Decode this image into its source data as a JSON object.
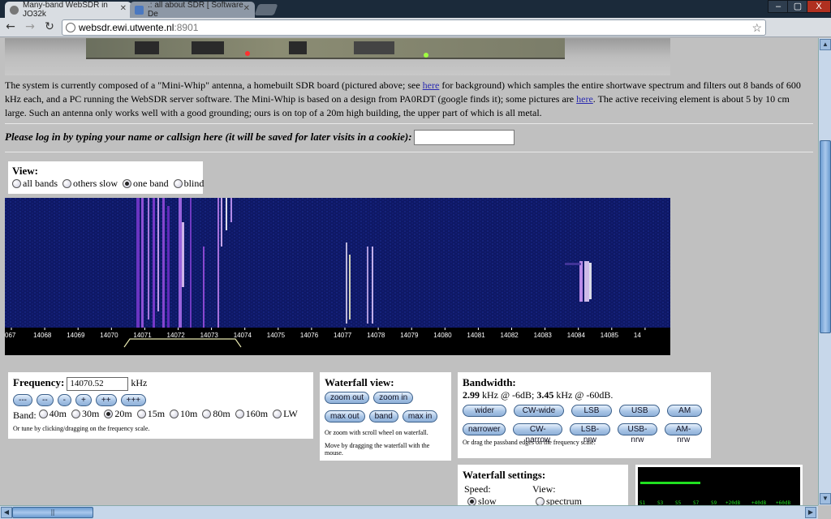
{
  "browser": {
    "tabs": [
      {
        "title": "Many-band WebSDR in JO32k",
        "active": true
      },
      {
        "title": ".: all about SDR [ Software De",
        "active": false
      }
    ],
    "window_controls": [
      "–",
      "▢",
      "X"
    ],
    "url_host": "websdr.ewi.utwente.nl",
    "url_port": ":8901"
  },
  "intro": {
    "p1": "The system is currently composed of a \"Mini-Whip\" antenna, a homebuilt SDR board (pictured above; see ",
    "link1": "here",
    "p2": " for background) which samples the entire shortwave spectrum and filters out 8 bands of 600 kHz each, and a PC running the WebSDR server software. The Mini-Whip is based on a design from PA0RDT (google finds it); some pictures are ",
    "link2": "here",
    "p3": ". The active receiving element is about 5 by 10 cm large. Such an antenna only works well with a good grounding; ours is on top of a 20m high building, the upper part of which is all metal."
  },
  "login": {
    "prompt": "Please log in by typing your name or callsign here (it will be saved for later visits in a cookie):",
    "value": ""
  },
  "view": {
    "title": "View:",
    "options": [
      "all bands",
      "others slow",
      "one band",
      "blind"
    ],
    "selected": "one band"
  },
  "waterfall": {
    "scale_labels": [
      "067",
      "14068",
      "14069",
      "14070",
      "14071",
      "14072",
      "14073",
      "14074",
      "14075",
      "14076",
      "14077",
      "14078",
      "14079",
      "14080",
      "14081",
      "14082",
      "14083",
      "14084",
      "14085",
      "14"
    ]
  },
  "frequency": {
    "label": "Frequency:",
    "value": "14070.52",
    "unit": "kHz",
    "step_buttons": [
      "---",
      "--",
      "-",
      "+",
      "++",
      "+++"
    ],
    "band_label": "Band:",
    "bands": [
      "40m",
      "30m",
      "20m",
      "15m",
      "10m",
      "80m",
      "160m",
      "LW"
    ],
    "selected_band": "20m",
    "note": "Or tune by clicking/dragging on the frequency scale."
  },
  "waterfall_view": {
    "title": "Waterfall view:",
    "buttons": [
      "zoom out",
      "zoom in",
      "max out",
      "band",
      "max in"
    ],
    "note1": "Or zoom with scroll wheel on waterfall.",
    "note2": "Move by dragging the waterfall with the mouse."
  },
  "bandwidth": {
    "title": "Bandwidth:",
    "v1": "2.99",
    "t1": " kHz @ -6dB; ",
    "v2": "3.45",
    "t2": " kHz @ -60dB.",
    "row1": [
      "wider",
      "CW-wide",
      "LSB",
      "USB",
      "AM"
    ],
    "row2": [
      "narrower",
      "CW-narrow",
      "LSB-nrw",
      "USB-nrw",
      "AM-nrw"
    ],
    "note": "Or drag the passband edges on the frequency scale."
  },
  "waterfall_settings": {
    "title": "Waterfall settings:",
    "speed_label": "Speed:",
    "speed_option": "slow",
    "view_label": "View:",
    "view_option": "spectrum"
  },
  "smeter": {
    "labels": [
      "S1",
      "S3",
      "S5",
      "S7",
      "S9",
      "+20dB",
      "+40dB",
      "+60dB"
    ],
    "level": 0.37
  },
  "colors": {
    "page_bg": "#c0c0c0",
    "waterfall_bg": "#101a6a",
    "link": "#2a2ab0",
    "meter_green": "#20e020"
  }
}
